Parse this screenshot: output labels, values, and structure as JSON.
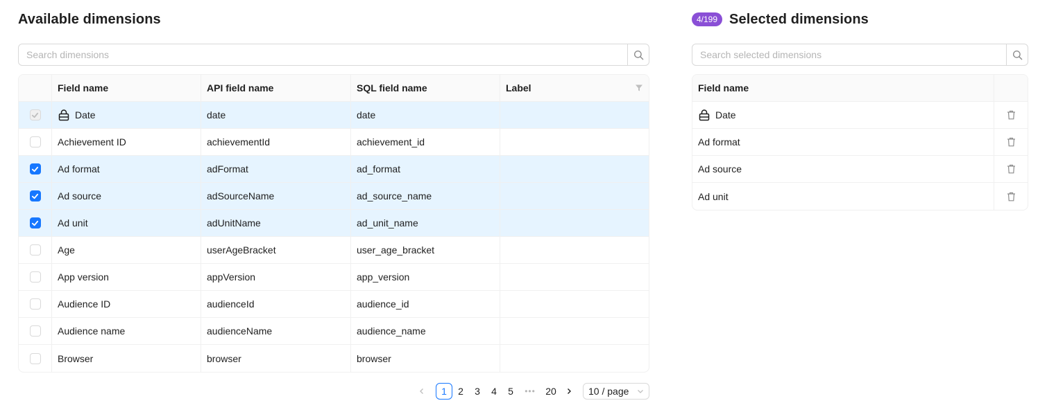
{
  "available": {
    "title": "Available dimensions",
    "search_placeholder": "Search dimensions",
    "columns": {
      "field": "Field name",
      "api": "API field name",
      "sql": "SQL field name",
      "label": "Label"
    },
    "rows": [
      {
        "field": "Date",
        "api": "date",
        "sql": "date",
        "label": "",
        "state": "locked"
      },
      {
        "field": "Achievement ID",
        "api": "achievementId",
        "sql": "achievement_id",
        "label": "",
        "state": "off"
      },
      {
        "field": "Ad format",
        "api": "adFormat",
        "sql": "ad_format",
        "label": "",
        "state": "on"
      },
      {
        "field": "Ad source",
        "api": "adSourceName",
        "sql": "ad_source_name",
        "label": "",
        "state": "on"
      },
      {
        "field": "Ad unit",
        "api": "adUnitName",
        "sql": "ad_unit_name",
        "label": "",
        "state": "on"
      },
      {
        "field": "Age",
        "api": "userAgeBracket",
        "sql": "user_age_bracket",
        "label": "",
        "state": "off"
      },
      {
        "field": "App version",
        "api": "appVersion",
        "sql": "app_version",
        "label": "",
        "state": "off"
      },
      {
        "field": "Audience ID",
        "api": "audienceId",
        "sql": "audience_id",
        "label": "",
        "state": "off"
      },
      {
        "field": "Audience name",
        "api": "audienceName",
        "sql": "audience_name",
        "label": "",
        "state": "off"
      },
      {
        "field": "Browser",
        "api": "browser",
        "sql": "browser",
        "label": "",
        "state": "off"
      }
    ],
    "pagination": {
      "pages": [
        "1",
        "2",
        "3",
        "4",
        "5"
      ],
      "current": "1",
      "ellipsis": "•••",
      "last": "20",
      "page_size": "10 / page"
    }
  },
  "selected": {
    "badge": "4/199",
    "title": "Selected dimensions",
    "search_placeholder": "Search selected dimensions",
    "column": "Field name",
    "rows": [
      {
        "field": "Date",
        "locked": true
      },
      {
        "field": "Ad format",
        "locked": false
      },
      {
        "field": "Ad source",
        "locked": false
      },
      {
        "field": "Ad unit",
        "locked": false
      }
    ]
  },
  "colors": {
    "accent": "#1677ff",
    "selected_row": "#e6f4ff",
    "badge": "#8a4fd6"
  }
}
